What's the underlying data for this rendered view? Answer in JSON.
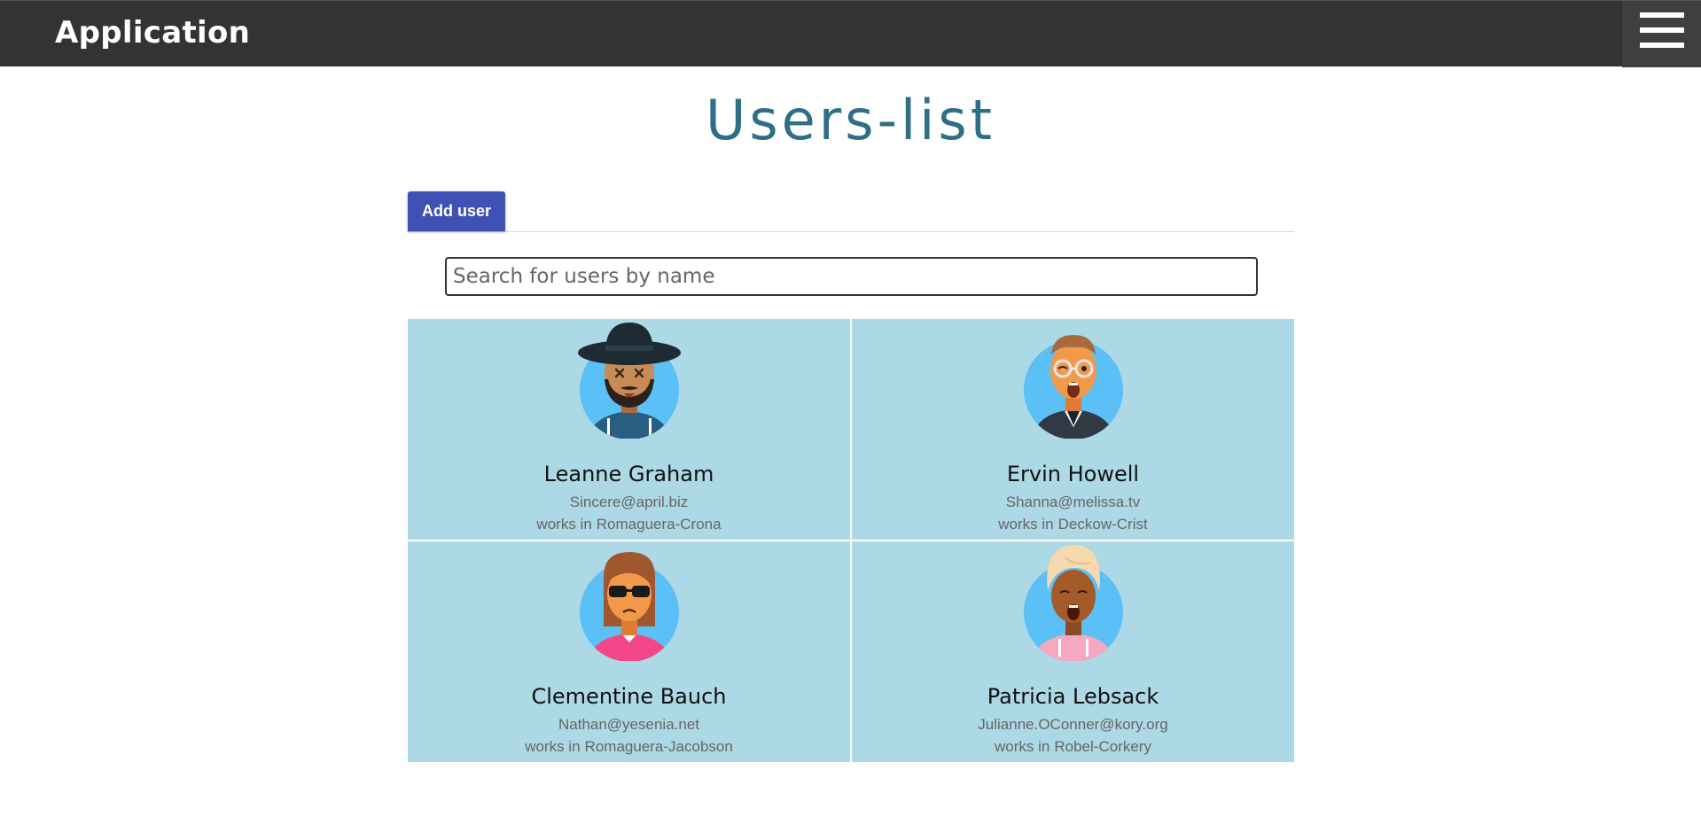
{
  "header": {
    "app_title": "Application",
    "menu_icon": "hamburger-menu-icon"
  },
  "page": {
    "title": "Users-list"
  },
  "tabs": {
    "add_user_label": "Add user"
  },
  "search": {
    "placeholder": "Search for users by name",
    "value": ""
  },
  "colors": {
    "header_bg": "#333333",
    "title": "#2e6f86",
    "accent": "#3f51b5",
    "card_bg": "#add8e6"
  },
  "users": [
    {
      "name": "Leanne Graham",
      "email": "Sincere@april.biz",
      "company_prefix": "works in",
      "company": "Romaguera-Crona",
      "avatar": "man-hat-beard-avatar-icon"
    },
    {
      "name": "Ervin Howell",
      "email": "Shanna@melissa.tv",
      "company_prefix": "works in",
      "company": "Deckow-Crist",
      "avatar": "man-glasses-avatar-icon"
    },
    {
      "name": "Clementine Bauch",
      "email": "Nathan@yesenia.net",
      "company_prefix": "works in",
      "company": "Romaguera-Jacobson",
      "avatar": "woman-sunglasses-avatar-icon"
    },
    {
      "name": "Patricia Lebsack",
      "email": "Julianne.OConner@kory.org",
      "company_prefix": "works in",
      "company": "Robel-Corkery",
      "avatar": "woman-blonde-avatar-icon"
    }
  ]
}
